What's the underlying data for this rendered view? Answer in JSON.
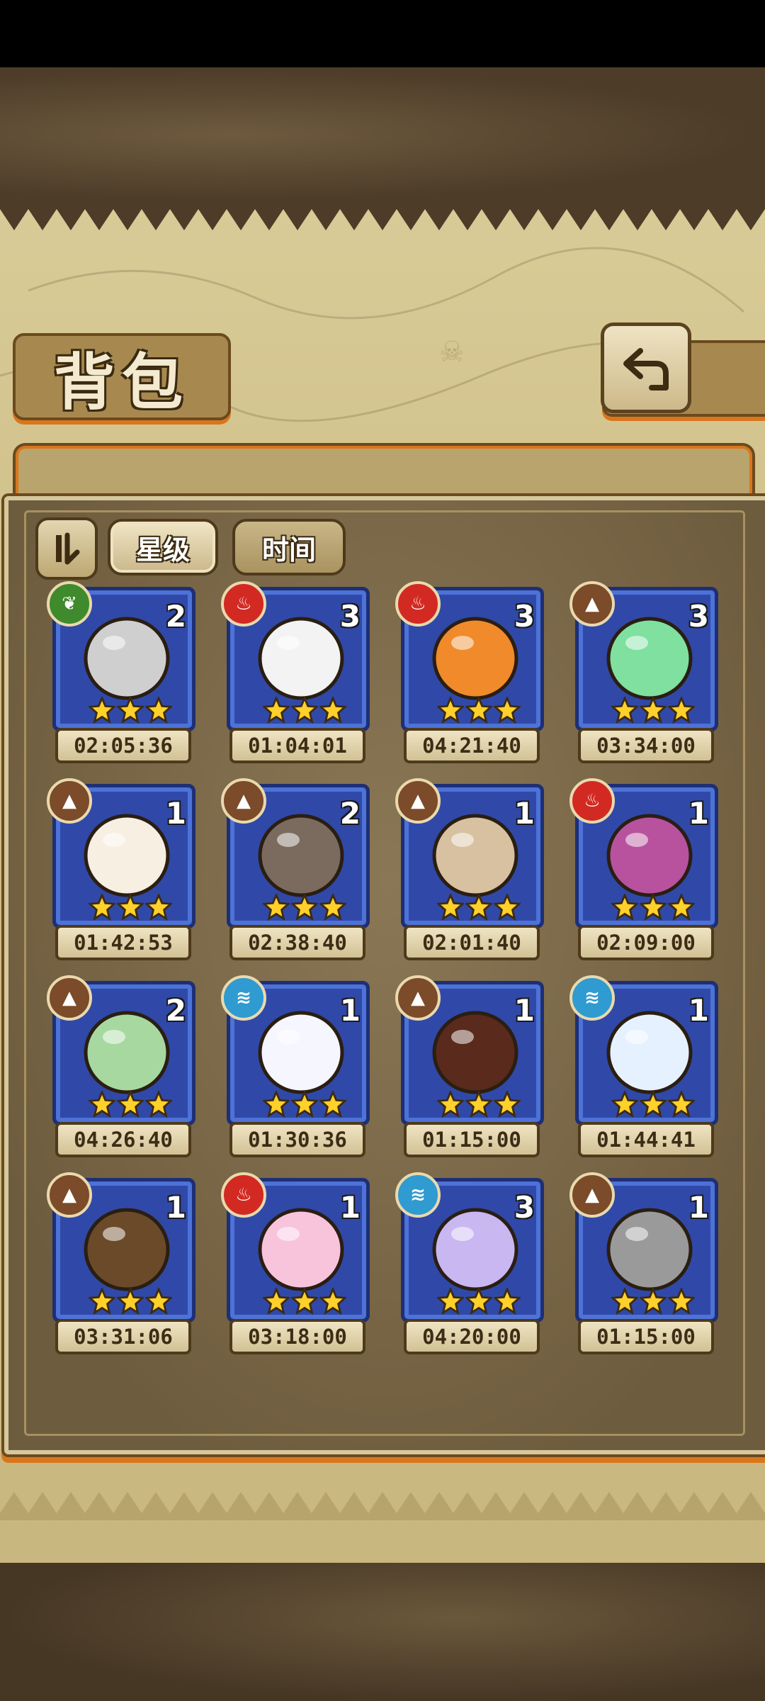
{
  "colors": {
    "element_nature": "#3f8a2c",
    "element_fire": "#d22a22",
    "element_earth": "#7b4b2a",
    "element_water": "#2f9bd0",
    "card_blue": "#3049a8",
    "accent_orange": "#d9761c"
  },
  "header": {
    "title": "背包",
    "back_icon": "back-arrow-icon"
  },
  "toolbar": {
    "sort_icon": "sort-order-icon",
    "filter_star_label": "星级",
    "filter_time_label": "时间",
    "active_filter": "星级"
  },
  "items": [
    {
      "element": "nature",
      "count": "2",
      "stars": 3,
      "time": "02:05:36"
    },
    {
      "element": "fire",
      "count": "3",
      "stars": 3,
      "time": "01:04:01"
    },
    {
      "element": "fire",
      "count": "3",
      "stars": 3,
      "time": "04:21:40"
    },
    {
      "element": "earth",
      "count": "3",
      "stars": 3,
      "time": "03:34:00"
    },
    {
      "element": "earth",
      "count": "1",
      "stars": 3,
      "time": "01:42:53"
    },
    {
      "element": "earth",
      "count": "2",
      "stars": 3,
      "time": "02:38:40"
    },
    {
      "element": "earth",
      "count": "1",
      "stars": 3,
      "time": "02:01:40"
    },
    {
      "element": "fire",
      "count": "1",
      "stars": 3,
      "time": "02:09:00"
    },
    {
      "element": "earth",
      "count": "2",
      "stars": 3,
      "time": "04:26:40"
    },
    {
      "element": "water",
      "count": "1",
      "stars": 3,
      "time": "01:30:36"
    },
    {
      "element": "earth",
      "count": "1",
      "stars": 3,
      "time": "01:15:00"
    },
    {
      "element": "water",
      "count": "1",
      "stars": 3,
      "time": "01:44:41"
    },
    {
      "element": "earth",
      "count": "1",
      "stars": 3,
      "time": "03:31:06"
    },
    {
      "element": "fire",
      "count": "1",
      "stars": 3,
      "time": "03:18:00"
    },
    {
      "element": "water",
      "count": "3",
      "stars": 3,
      "time": "04:20:00"
    },
    {
      "element": "earth",
      "count": "1",
      "stars": 3,
      "time": "01:15:00"
    }
  ]
}
